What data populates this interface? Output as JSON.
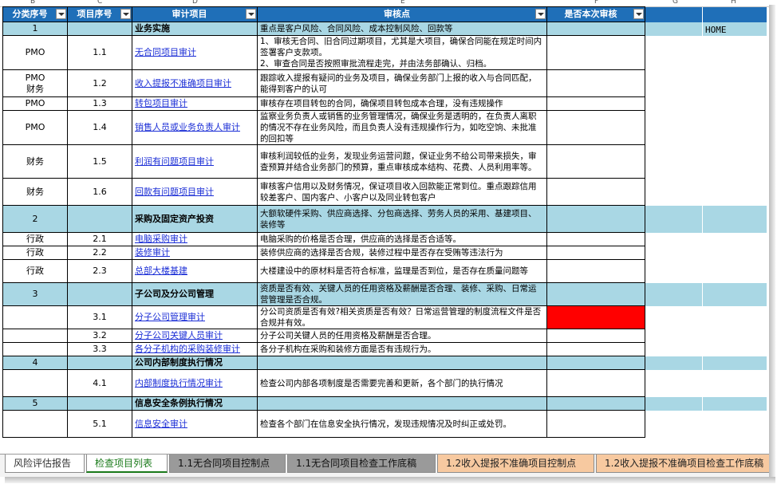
{
  "columns": [
    "B",
    "C",
    "D",
    "E",
    "F",
    "G",
    "H"
  ],
  "header": {
    "category_no": "分类序号",
    "item_no": "项目序号",
    "audit_item": "审计项目",
    "review_points": "审核点",
    "reviewed": "是否本次审核"
  },
  "home_label": "HOME",
  "rows": [
    {
      "type": "section",
      "a": "1",
      "b": "",
      "c": "业务实施",
      "d": "重点是客户风险、合同风险、成本控制风险、回款等",
      "e": ""
    },
    {
      "type": "item",
      "a": "PMO",
      "b": "1.1",
      "c": "无合同项目审计",
      "d": "1、审核无合同、旧合同过期项目，尤其是大项目，确保合同能在规定时间内签署客户支款项。\n2、审查合同是否按照审批流程走完，并由法务部确认、归档。",
      "e": ""
    },
    {
      "type": "item",
      "a": "PMO\n财务",
      "b": "1.2",
      "c": "收入提报不准确项目审计",
      "d": "跟踪收入提报有疑问的业务及项目，确保业务部门上报的收入与合同匹配，能得到客户的认可",
      "e": ""
    },
    {
      "type": "item",
      "a": "PMO",
      "b": "1.3",
      "c": "转包项目审计",
      "d": "审核存在项目转包的合同，确保项目转包成本合理，没有违规操作",
      "e": ""
    },
    {
      "type": "item",
      "a": "PMO",
      "b": "1.4",
      "c": "销售人员或业务负责人审计",
      "d": "监察业务负责人或销售的业务管理情况，确保业务是透明的，在负责人离职的情况不存在业务风险，而且负责人没有违规操作行为，如吃空饷、未批准的回扣等",
      "e": ""
    },
    {
      "type": "item",
      "a": "财务",
      "b": "1.5",
      "c": "利润有问题项目审计",
      "d": "审核利润较低的业务，发现业务运营问题，保证业务不给公司带来损失，审查预算并结合业务部门的预算，重点审核成本结构、花费、人员利用率等。",
      "e": ""
    },
    {
      "type": "item",
      "a": "财务",
      "b": "1.6",
      "c": "回款有问题项目审计",
      "d": "审核客户信用以及财务情况，保证项目收入回款能正常到位。重点跟踪信用较差客户、国内客户、小客户以及同业转包客户",
      "e": ""
    },
    {
      "type": "section",
      "a": "2",
      "b": "",
      "c": "采购及固定资产投资",
      "d": "大额软硬件采购、供应商选择、分包商选择、劳务人员的采用、基建项目、装修等",
      "e": ""
    },
    {
      "type": "item",
      "a": "行政",
      "b": "2.1",
      "c": "电脑采购审计",
      "d": "电脑采购的价格是否合理，供应商的选择是否合适等。",
      "e": ""
    },
    {
      "type": "item",
      "a": "行政",
      "b": "2.2",
      "c": "装修审计",
      "d": "装修供应商的选择是否合规，装修过程中是否存在受贿等违法行为",
      "e": ""
    },
    {
      "type": "item",
      "a": "行政",
      "b": "2.3",
      "c": "总部大楼基建",
      "d": "大楼建设中的原材料是否符合标准，监理是否到位，是否存在质量问题等",
      "e": ""
    },
    {
      "type": "section",
      "a": "3",
      "b": "",
      "c": "子公司及分公司管理",
      "d": "资质是否有效、关键人员的任用资格及薪酬是否合理、装修、采购、日常运营管理是否合规。",
      "e": ""
    },
    {
      "type": "item",
      "a": "",
      "b": "3.1",
      "c": "分子公司管理审计",
      "d": "分公司资质是否有效?相关资质是否有效？日常运营管理的制度流程文件是否合规并有效。",
      "e": "",
      "flag": "red"
    },
    {
      "type": "item",
      "a": "",
      "b": "3.2",
      "c": "分子公司关键人员审计",
      "d": "分子公司关键人员的任用资格及薪酬是否合理。",
      "e": ""
    },
    {
      "type": "item",
      "a": "",
      "b": "3.3",
      "c": "各分子机构的采购装修审计",
      "d": "各分子机构在采购和装修方面是否有违规行为。",
      "e": ""
    },
    {
      "type": "section",
      "a": "4",
      "b": "",
      "c": "公司内部制度执行情况",
      "d": "",
      "e": ""
    },
    {
      "type": "item",
      "a": "",
      "b": "4.1",
      "c": "内部制度执行情况审计",
      "d": "检查公司内部各项制度是否需要完善和更新，各个部门的执行情况",
      "e": ""
    },
    {
      "type": "section",
      "a": "5",
      "b": "",
      "c": "信息安全条例执行情况",
      "d": "",
      "e": ""
    },
    {
      "type": "item",
      "a": "",
      "b": "5.1",
      "c": "信息安全审计",
      "d": "检查各个部门在信息安全执行情况，发现违规情况及时纠正或处罚。",
      "e": ""
    }
  ],
  "tabs": [
    {
      "label": "风险评估报告",
      "style": "white"
    },
    {
      "label": "检查项目列表",
      "style": "active"
    },
    {
      "label": "1.1无合同项目控制点",
      "style": "gray"
    },
    {
      "label": "1.1无合同项目检查工作底稿",
      "style": "gray"
    },
    {
      "label": "1.2收入提报不准确项目控制点",
      "style": "orange"
    },
    {
      "label": "1.2收入提报不准确项目检查工作底稿",
      "style": "orange"
    }
  ],
  "colors": {
    "header_bg": "#1f6fb8",
    "section_bg": "#a9d7e4",
    "link": "#1c2fd6",
    "flag_red": "#ff0000",
    "active_tab": "#1a7a1a",
    "gray_tab": "#9a9a9a",
    "orange_tab": "#f7c9a0"
  }
}
